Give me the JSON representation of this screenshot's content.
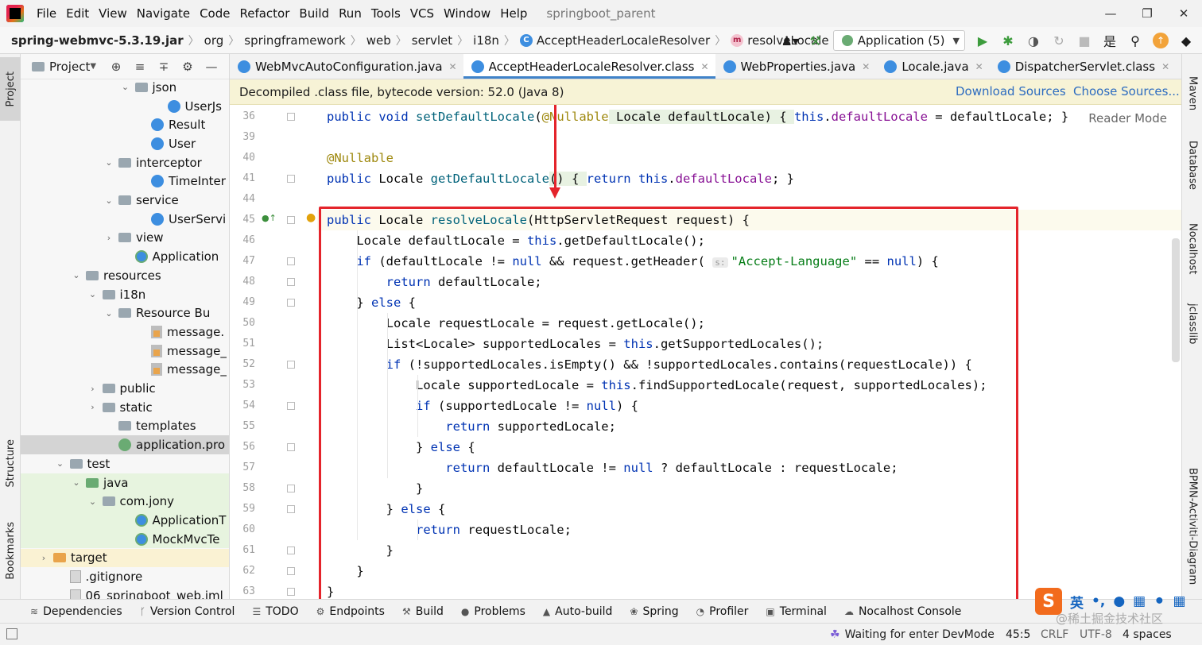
{
  "menubar": {
    "items": [
      "File",
      "Edit",
      "View",
      "Navigate",
      "Code",
      "Refactor",
      "Build",
      "Run",
      "Tools",
      "VCS",
      "Window",
      "Help"
    ],
    "project_title": "springboot_parent",
    "win_min": "—",
    "win_max": "❐",
    "win_close": "✕"
  },
  "navbar": {
    "crumbs": [
      "spring-webmvc-5.3.19.jar",
      "org",
      "springframework",
      "web",
      "servlet",
      "i18n",
      "AcceptHeaderLocaleResolver",
      "resolveLocale"
    ],
    "sep": "〉",
    "run_config": "Application (5)",
    "class_badge": "C",
    "method_badge": "m"
  },
  "left_stripe": {
    "project": "Project",
    "structure": "Structure",
    "bookmarks": "Bookmarks"
  },
  "project_panel": {
    "header": "Project",
    "tree": [
      {
        "label": "json",
        "type": "folder",
        "depth": 7,
        "arrow": "⌄"
      },
      {
        "label": "UserJs",
        "type": "class",
        "depth": 9,
        "arrow": ""
      },
      {
        "label": "Result",
        "type": "class",
        "depth": 8,
        "arrow": ""
      },
      {
        "label": "User",
        "type": "class",
        "depth": 8,
        "arrow": ""
      },
      {
        "label": "interceptor",
        "type": "folder",
        "depth": 6,
        "arrow": "⌄"
      },
      {
        "label": "TimeInter",
        "type": "class",
        "depth": 8,
        "arrow": ""
      },
      {
        "label": "service",
        "type": "folder",
        "depth": 6,
        "arrow": "⌄"
      },
      {
        "label": "UserServi",
        "type": "class",
        "depth": 8,
        "arrow": ""
      },
      {
        "label": "view",
        "type": "folder",
        "depth": 6,
        "arrow": "›"
      },
      {
        "label": "Application",
        "type": "app",
        "depth": 7,
        "arrow": ""
      },
      {
        "label": "resources",
        "type": "folder",
        "depth": 4,
        "arrow": "⌄"
      },
      {
        "label": "i18n",
        "type": "folder",
        "depth": 5,
        "arrow": "⌄"
      },
      {
        "label": "Resource Bu",
        "type": "folder",
        "depth": 6,
        "arrow": "⌄"
      },
      {
        "label": "message.",
        "type": "props",
        "depth": 8,
        "arrow": ""
      },
      {
        "label": "message_",
        "type": "props",
        "depth": 8,
        "arrow": ""
      },
      {
        "label": "message_",
        "type": "props",
        "depth": 8,
        "arrow": ""
      },
      {
        "label": "public",
        "type": "folder",
        "depth": 5,
        "arrow": "›"
      },
      {
        "label": "static",
        "type": "folder",
        "depth": 5,
        "arrow": "›"
      },
      {
        "label": "templates",
        "type": "folder",
        "depth": 6,
        "arrow": ""
      },
      {
        "label": "application.pro",
        "type": "spring",
        "depth": 6,
        "arrow": "",
        "selected": true
      },
      {
        "label": "test",
        "type": "folder",
        "depth": 3,
        "arrow": "⌄"
      },
      {
        "label": "java",
        "type": "folder-green",
        "depth": 4,
        "arrow": "⌄",
        "test": true
      },
      {
        "label": "com.jony",
        "type": "folder",
        "depth": 5,
        "arrow": "⌄",
        "test": true
      },
      {
        "label": "ApplicationT",
        "type": "app",
        "depth": 7,
        "arrow": "",
        "test": true
      },
      {
        "label": "MockMvcTe",
        "type": "app",
        "depth": 7,
        "arrow": "",
        "test": true
      },
      {
        "label": "target",
        "type": "folder-orange",
        "depth": 2,
        "arrow": "›",
        "target": true
      },
      {
        "label": ".gitignore",
        "type": "plain",
        "depth": 3,
        "arrow": ""
      },
      {
        "label": "06_springboot_web.iml",
        "type": "plain",
        "depth": 3,
        "arrow": ""
      }
    ]
  },
  "tabs": [
    {
      "label": "WebMvcAutoConfiguration.java",
      "active": false
    },
    {
      "label": "AcceptHeaderLocaleResolver.class",
      "active": true
    },
    {
      "label": "WebProperties.java",
      "active": false
    },
    {
      "label": "Locale.java",
      "active": false
    },
    {
      "label": "DispatcherServlet.class",
      "active": false
    }
  ],
  "tab_close": "✕",
  "banner": {
    "text": "Decompiled .class file, bytecode version: 52.0 (Java 8)",
    "download": "Download Sources",
    "choose": "Choose Sources..."
  },
  "editor": {
    "reader_mode": "Reader Mode",
    "param_hint": "s:",
    "lines": [
      {
        "n": "36",
        "parts": [
          [
            "kw",
            "public "
          ],
          [
            "kw",
            "void "
          ],
          [
            "fn",
            "setDefaultLocale"
          ],
          [
            "",
            "("
          ],
          [
            "ann",
            "@Nullable"
          ],
          [
            "",
            " Locale defaultLocale) { "
          ],
          [
            "kw",
            "this"
          ],
          [
            "",
            "."
          ],
          [
            "fld",
            "defaultLocale"
          ],
          [
            "",
            " = defaultLocale; }"
          ]
        ]
      },
      {
        "n": "39",
        "parts": []
      },
      {
        "n": "40",
        "parts": [
          [
            "ann",
            "@Nullable"
          ]
        ]
      },
      {
        "n": "41",
        "parts": [
          [
            "kw",
            "public "
          ],
          [
            "",
            "Locale "
          ],
          [
            "fn",
            "getDefaultLocale"
          ],
          [
            "",
            "() { "
          ],
          [
            "kw",
            "return this"
          ],
          [
            "",
            "."
          ],
          [
            "fld",
            "defaultLocale"
          ],
          [
            "",
            "; }"
          ]
        ]
      },
      {
        "n": "44",
        "parts": []
      },
      {
        "n": "45",
        "parts": [
          [
            "kw",
            "public "
          ],
          [
            "",
            "Locale "
          ],
          [
            "fn",
            "resolveLocale"
          ],
          [
            "",
            "(HttpServletRequest request) {"
          ]
        ]
      },
      {
        "n": "46",
        "parts": [
          [
            "",
            "    Locale defaultLocale = "
          ],
          [
            "kw",
            "this"
          ],
          [
            "",
            ".getDefaultLocale();"
          ]
        ]
      },
      {
        "n": "47",
        "parts": [
          [
            "kw",
            "    if "
          ],
          [
            "",
            "(defaultLocale != "
          ],
          [
            "kw",
            "null"
          ],
          [
            "",
            " && request.getHeader( "
          ],
          [
            "hint",
            "s:"
          ],
          [
            "str",
            "\"Accept-Language\""
          ],
          [
            "",
            " == "
          ],
          [
            "kw",
            "null"
          ],
          [
            "",
            ") {"
          ]
        ]
      },
      {
        "n": "48",
        "parts": [
          [
            "kw",
            "        return "
          ],
          [
            "",
            "defaultLocale;"
          ]
        ]
      },
      {
        "n": "49",
        "parts": [
          [
            "",
            "    } "
          ],
          [
            "kw",
            "else "
          ],
          [
            "",
            "{"
          ]
        ]
      },
      {
        "n": "50",
        "parts": [
          [
            "",
            "        Locale requestLocale = request.getLocale();"
          ]
        ]
      },
      {
        "n": "51",
        "parts": [
          [
            "",
            "        List<Locale> supportedLocales = "
          ],
          [
            "kw",
            "this"
          ],
          [
            "",
            ".getSupportedLocales();"
          ]
        ]
      },
      {
        "n": "52",
        "parts": [
          [
            "kw",
            "        if "
          ],
          [
            "",
            "(!supportedLocales.isEmpty() && !supportedLocales.contains(requestLocale)) {"
          ]
        ]
      },
      {
        "n": "53",
        "parts": [
          [
            "",
            "            Locale supportedLocale = "
          ],
          [
            "kw",
            "this"
          ],
          [
            "",
            ".findSupportedLocale(request, supportedLocales);"
          ]
        ]
      },
      {
        "n": "54",
        "parts": [
          [
            "kw",
            "            if "
          ],
          [
            "",
            "(supportedLocale != "
          ],
          [
            "kw",
            "null"
          ],
          [
            "",
            ") {"
          ]
        ]
      },
      {
        "n": "55",
        "parts": [
          [
            "kw",
            "                return "
          ],
          [
            "",
            "supportedLocale;"
          ]
        ]
      },
      {
        "n": "56",
        "parts": [
          [
            "",
            "            } "
          ],
          [
            "kw",
            "else "
          ],
          [
            "",
            "{"
          ]
        ]
      },
      {
        "n": "57",
        "parts": [
          [
            "kw",
            "                return "
          ],
          [
            "",
            "defaultLocale != "
          ],
          [
            "kw",
            "null "
          ],
          [
            "",
            "? defaultLocale : requestLocale;"
          ]
        ]
      },
      {
        "n": "58",
        "parts": [
          [
            "",
            "            }"
          ]
        ]
      },
      {
        "n": "59",
        "parts": [
          [
            "",
            "        } "
          ],
          [
            "kw",
            "else "
          ],
          [
            "",
            "{"
          ]
        ]
      },
      {
        "n": "60",
        "parts": [
          [
            "kw",
            "            return "
          ],
          [
            "",
            "requestLocale;"
          ]
        ]
      },
      {
        "n": "61",
        "parts": [
          [
            "",
            "        }"
          ]
        ]
      },
      {
        "n": "62",
        "parts": [
          [
            "",
            "    }"
          ]
        ]
      },
      {
        "n": "63",
        "parts": [
          [
            "",
            "}"
          ]
        ]
      }
    ]
  },
  "right_stripe": {
    "maven": "Maven",
    "database": "Database",
    "nocalhost": "Nocalhost",
    "jclasslib": "jclasslib",
    "bpmn": "BPMN-Activiti-Diagram"
  },
  "bottom_tools": [
    {
      "icon": "dependencies-icon",
      "glyph": "≋",
      "label": "Dependencies"
    },
    {
      "icon": "vcs-icon",
      "glyph": "ᚴ",
      "label": "Version Control"
    },
    {
      "icon": "todo-icon",
      "glyph": "☰",
      "label": "TODO"
    },
    {
      "icon": "endpoints-icon",
      "glyph": "⚙",
      "label": "Endpoints"
    },
    {
      "icon": "build-icon",
      "glyph": "⚒",
      "label": "Build"
    },
    {
      "icon": "problems-icon",
      "glyph": "●",
      "label": "Problems"
    },
    {
      "icon": "autobuild-icon",
      "glyph": "▲",
      "label": "Auto-build"
    },
    {
      "icon": "spring-icon",
      "glyph": "❀",
      "label": "Spring"
    },
    {
      "icon": "profiler-icon",
      "glyph": "◔",
      "label": "Profiler"
    },
    {
      "icon": "terminal-icon",
      "glyph": "▣",
      "label": "Terminal"
    },
    {
      "icon": "nocalhost-icon",
      "glyph": "☁",
      "label": "Nocalhost Console"
    }
  ],
  "status": {
    "message": "Waiting for enter DevMode",
    "position": "45:5",
    "line_sep": "CRLF",
    "encoding": "UTF-8",
    "indent": "4 spaces"
  },
  "ime": {
    "logo": "S",
    "lang": "英",
    "punct": "•,"
  },
  "watermark": "@稀土掘金技术社区",
  "colors": {
    "keyword": "#0033b3",
    "function": "#00627a",
    "field": "#871094",
    "string": "#067d17",
    "annotation": "#9e880d",
    "highlight": "#e4242b",
    "link": "#2d6cc0"
  }
}
